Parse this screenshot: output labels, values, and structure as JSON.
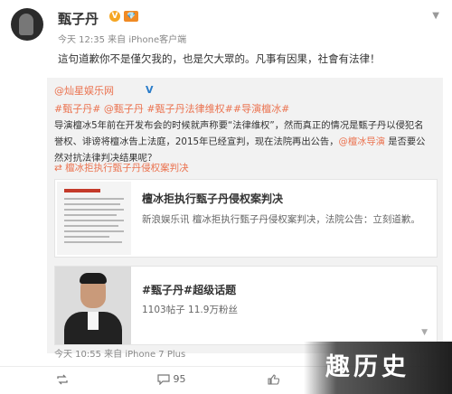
{
  "post": {
    "author": "甄子丹",
    "verified_badge": "V",
    "member_badge": "💎",
    "meta": "今天 12:35 来自 iPhone客户端",
    "text": "這句道歉你不是僅欠我的，也是欠大眾的。凡事有因果，社會有法律！"
  },
  "repost": {
    "author": "@灿星娱乐网",
    "verified_badge": "V",
    "tags": "#甄子丹# @甄子丹 #甄子丹法律维权##导演檀冰#",
    "text_part1": "导演檀冰5年前在开发布会的时候就声称要“法律维权”，然而真正的情况是甄子丹以侵犯名誉权、诽谤将檀冰告上法庭，2015年已经宣判，现在法院再出公告，",
    "text_mention": "@檀冰导演",
    "text_part2": " 是否要公然对抗法律判决结果呢？",
    "link_label": "檀冰拒执行甄子丹侵权案判决",
    "card1": {
      "title": "檀冰拒执行甄子丹侵权案判决",
      "desc": "新浪娱乐讯 檀冰拒执行甄子丹侵权案判决，法院公告：立刻道歉。"
    },
    "card2": {
      "title": "#甄子丹#超级话题",
      "stats": "1103帖子 11.9万粉丝",
      "more": "▼"
    },
    "time": "今天 10:55 来自 iPhone 7 Plus"
  },
  "actions": {
    "repost_count": "",
    "comment_count": "95",
    "like_count": ""
  },
  "watermark": "趣历史",
  "icons": {
    "dropdown": "chevron-down-icon",
    "repost": "repost-icon",
    "comment": "comment-icon",
    "like": "like-icon"
  },
  "colors": {
    "accent": "#eb7350",
    "link_blue": "#2a7cc9",
    "repost_bg": "#f2f2f2"
  }
}
